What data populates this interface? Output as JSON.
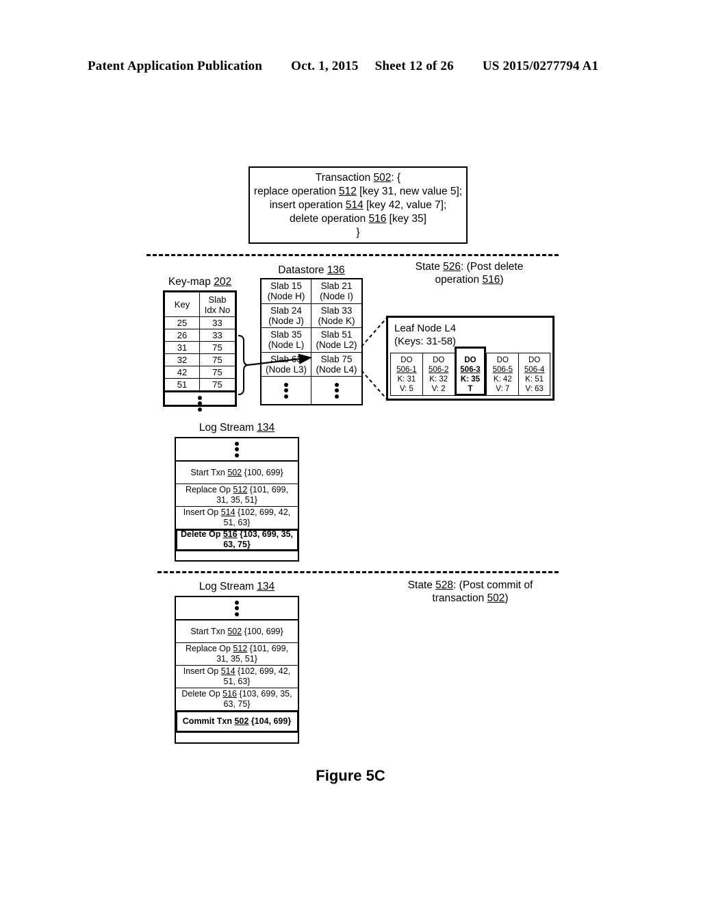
{
  "header": {
    "publication": "Patent Application Publication",
    "date": "Oct. 1, 2015",
    "sheet": "Sheet 12 of 26",
    "patent_number": "US 2015/0277794 A1"
  },
  "figure_caption": "Figure 5C",
  "transaction": {
    "line1": "Transaction 502: {",
    "line2": "replace operation 512 [key 31, new value 5];",
    "line3": "insert operation 514 [key 42, value 7];",
    "line4": "delete operation 516 [key 35]",
    "line5": "}"
  },
  "keymap": {
    "title": "Key-map 202",
    "headers": [
      "Key",
      "Slab Idx No"
    ],
    "header_col2_line1": "Slab",
    "header_col2_line2": "Idx No",
    "rows": [
      {
        "key": "25",
        "slab": "33"
      },
      {
        "key": "26",
        "slab": "33"
      },
      {
        "key": "31",
        "slab": "75"
      },
      {
        "key": "32",
        "slab": "75"
      },
      {
        "key": "42",
        "slab": "75"
      },
      {
        "key": "51",
        "slab": "75"
      }
    ],
    "ellipsis": "vertical-ellipsis"
  },
  "datastore": {
    "title": "Datastore 136",
    "slabs": [
      [
        {
          "slab": "Slab 15",
          "node": "(Node H)"
        },
        {
          "slab": "Slab 21",
          "node": "(Node I)"
        }
      ],
      [
        {
          "slab": "Slab 24",
          "node": "(Node J)"
        },
        {
          "slab": "Slab 33",
          "node": "(Node K)"
        }
      ],
      [
        {
          "slab": "Slab 35",
          "node": "(Node L)"
        },
        {
          "slab": "Slab 51",
          "node": "(Node L2)"
        }
      ],
      [
        {
          "slab": "Slab 63",
          "node": "(Node L3)"
        },
        {
          "slab": "Slab 75",
          "node": "(Node L4)"
        }
      ]
    ],
    "ellipsis": "vertical-ellipsis"
  },
  "state526": {
    "line1": "State 526: (Post delete",
    "line2": "operation 516)"
  },
  "state528": {
    "line1": "State 528: (Post commit of",
    "line2": "transaction 502)"
  },
  "leaf_node": {
    "title": "Leaf Node L4",
    "keys_range": "(Keys: 31-58)",
    "data_objects": [
      {
        "type": "DO",
        "id": "506-1",
        "key": "K: 31",
        "value": "V: 5",
        "highlighted": false
      },
      {
        "type": "DO",
        "id": "506-2",
        "key": "K: 32",
        "value": "V: 2",
        "highlighted": false
      },
      {
        "type": "DO",
        "id": "506-3",
        "key": "K: 35",
        "value": "T",
        "highlighted": true
      },
      {
        "type": "DO",
        "id": "506-5",
        "key": "K: 42",
        "value": "V: 7",
        "highlighted": false
      },
      {
        "type": "DO",
        "id": "506-4",
        "key": "K: 51",
        "value": "V: 63",
        "highlighted": false
      }
    ]
  },
  "logstream1": {
    "title": "Log Stream 134",
    "entries": [
      {
        "kind": "ellipsis",
        "line1": "",
        "line2": "",
        "highlighted": false
      },
      {
        "kind": "entry",
        "line1": "Start Txn 502 {100, 699}",
        "line2": "",
        "highlighted": false
      },
      {
        "kind": "entry",
        "line1": "Replace Op 512 {101, 699,",
        "line2": "31, 35, 51}",
        "highlighted": false
      },
      {
        "kind": "entry",
        "line1": "Insert Op 514 {102, 699, 42,",
        "line2": "51, 63}",
        "highlighted": false
      },
      {
        "kind": "entry",
        "line1": "Delete Op 516 {103, 699, 35,",
        "line2": "63, 75}",
        "highlighted": true
      }
    ]
  },
  "logstream2": {
    "title": "Log Stream 134",
    "entries": [
      {
        "kind": "ellipsis",
        "line1": "",
        "line2": "",
        "highlighted": false
      },
      {
        "kind": "entry",
        "line1": "Start Txn 502 {100, 699}",
        "line2": "",
        "highlighted": false
      },
      {
        "kind": "entry",
        "line1": "Replace Op 512 {101, 699,",
        "line2": "31, 35, 51}",
        "highlighted": false
      },
      {
        "kind": "entry",
        "line1": "Insert Op 514 {102, 699, 42,",
        "line2": "51, 63}",
        "highlighted": false
      },
      {
        "kind": "entry",
        "line1": "Delete Op 516 {103, 699, 35,",
        "line2": "63, 75}",
        "highlighted": false
      },
      {
        "kind": "entry",
        "line1": "Commit Txn 502 {104, 699}",
        "line2": "",
        "highlighted": true
      }
    ]
  },
  "colors": {
    "ink": "#000000",
    "paper": "#ffffff"
  }
}
